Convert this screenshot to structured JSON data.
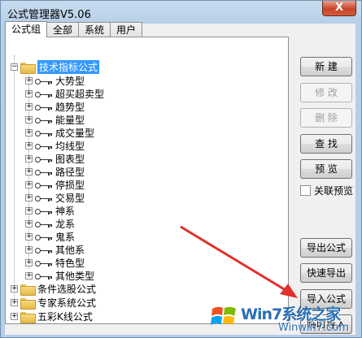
{
  "window": {
    "title": "公式管理器V5.06",
    "close_label": "X"
  },
  "tabs": [
    "公式组",
    "全部",
    "系统",
    "用户"
  ],
  "tree": {
    "root": {
      "label": "技术指标公式",
      "expander": "−"
    },
    "children": [
      "大势型",
      "超买超卖型",
      "趋势型",
      "能量型",
      "成交量型",
      "均线型",
      "图表型",
      "路径型",
      "停损型",
      "交易型",
      "神系",
      "龙系",
      "鬼系",
      "其他系",
      "特色型",
      "其他类型"
    ],
    "child_expander": "+",
    "groups": [
      {
        "label": "条件选股公式",
        "expander": "+"
      },
      {
        "label": "专家系统公式",
        "expander": "+"
      },
      {
        "label": "五彩K线公式",
        "expander": "+"
      }
    ]
  },
  "buttons": {
    "new": "新  建",
    "modify": "修  改",
    "delete": "删  除",
    "find": "查  找",
    "preview": "预  览",
    "export": "导出公式",
    "quick_export": "快速导出",
    "import": "导入公式",
    "temp_import": "临时导入"
  },
  "checkbox": {
    "label": "关联预览",
    "checked": false
  },
  "watermark": {
    "brand": "Win7系统之家",
    "site": "Winwin7.com"
  },
  "colors": {
    "selection": "#3399ff",
    "arrow": "#e0312b",
    "watermark": "#2a6fb3"
  }
}
